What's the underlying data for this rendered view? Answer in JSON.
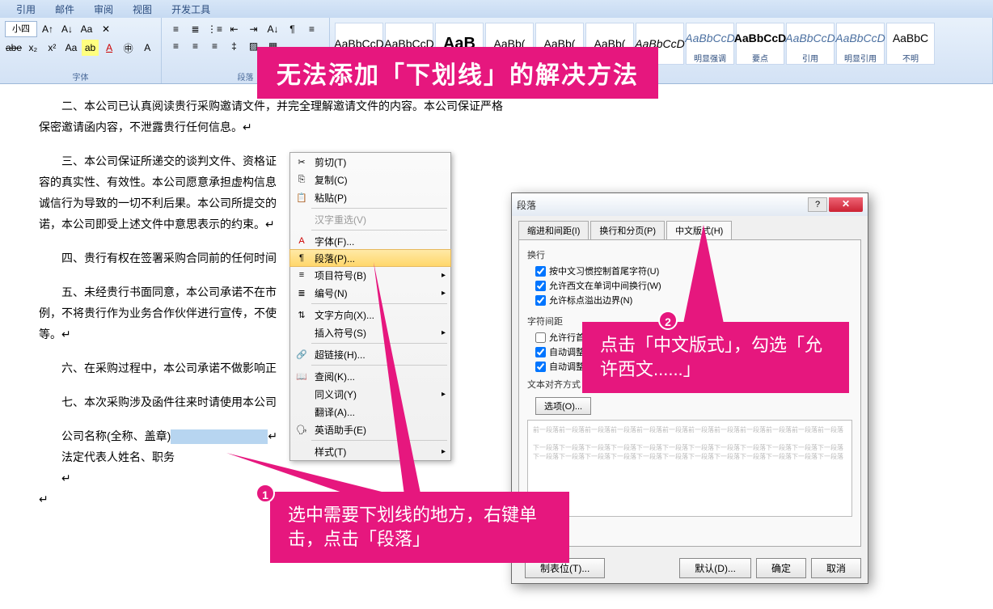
{
  "tabs": [
    "引用",
    "邮件",
    "审阅",
    "视图",
    "开发工具"
  ],
  "font": {
    "size": "小四",
    "group": "字体"
  },
  "para": {
    "group": "段落"
  },
  "styles": [
    {
      "prev": "AaBbCcD",
      "name": ""
    },
    {
      "prev": "AaBbCcD",
      "name": ""
    },
    {
      "prev": "AaB",
      "name": "",
      "bold": true,
      "big": true
    },
    {
      "prev": "AaBb(",
      "name": ""
    },
    {
      "prev": "AaBb(",
      "name": ""
    },
    {
      "prev": "AaBb(",
      "name": ""
    },
    {
      "prev": "AaBbCcD",
      "name": "",
      "italic": true
    },
    {
      "prev": "AaBbCcD",
      "name": "明显强调",
      "italic": true,
      "color": "#4a6fa0"
    },
    {
      "prev": "AaBbCcD",
      "name": "要点",
      "bold": true
    },
    {
      "prev": "AaBbCcD",
      "name": "引用",
      "italic": true,
      "color": "#4a6fa0"
    },
    {
      "prev": "AaBbCcD",
      "name": "明显引用",
      "italic": true,
      "color": "#4a6fa0"
    },
    {
      "prev": "AaBbC",
      "name": "不明"
    }
  ],
  "doc": {
    "p1": "二、本公司已认真阅读贵行采购邀请文件，并完全理解邀请文件的内容。本公司保证严格保密邀请函内容，不泄露贵行任何信息。↵",
    "p2": "三、本公司保证所递交的谈判文件、资格证",
    "p3": "容的真实性、有效性。本公司愿意承担虚构信息",
    "p4": "诚信行为导致的一切不利后果。本公司所提交的",
    "p5": "诺，本公司即受上述文件中意思表示的约束。↵",
    "p6": "四、贵行有权在签署采购合同前的任何时间",
    "p7": "五、未经贵行书面同意，本公司承诺不在市",
    "p8": "例，不将贵行作为业务合作伙伴进行宣传，不使",
    "p9": "等。↵",
    "p10": "六、在采购过程中，本公司承诺不做影响正",
    "p11": "七、本次采购涉及函件往来时请使用本公司",
    "p12": "公司名称(全称、盖章)",
    "p13": "法定代表人姓名、职务"
  },
  "ctx": {
    "cut": "剪切(T)",
    "copy": "复制(C)",
    "paste": "粘贴(P)",
    "recon": "汉字重选(V)",
    "font": "字体(F)...",
    "para": "段落(P)...",
    "bullets": "项目符号(B)",
    "number": "编号(N)",
    "dir": "文字方向(X)...",
    "symbol": "插入符号(S)",
    "link": "超链接(H)...",
    "lookup": "查阅(K)...",
    "syn": "同义词(Y)",
    "trans": "翻译(A)...",
    "eng": "英语助手(E)",
    "style": "样式(T)"
  },
  "dlg": {
    "title": "段落",
    "tab1": "缩进和间距(I)",
    "tab2": "换行和分页(P)",
    "tab3": "中文版式(H)",
    "grp1": "换行",
    "chk1": "按中文习惯控制首尾字符(U)",
    "chk2": "允许西文在单词中间换行(W)",
    "chk3": "允许标点溢出边界(N)",
    "grp2": "字符间距",
    "chk4": "允许行首标点压缩(C)",
    "chk5": "自动调整中文与西文的间距",
    "chk6": "自动调整中文与数字的间距",
    "grp3": "文本对齐方式",
    "opt": "选项(O)...",
    "tabsbtn": "制表位(T)...",
    "def": "默认(D)...",
    "ok": "确定",
    "cancel": "取消"
  },
  "anno": {
    "title": "无法添加「下划线」的解决方法",
    "a1": "选中需要下划线的地方，右键单击，点击「段落」",
    "a2": "点击「中文版式」，勾选「允许西文......」"
  }
}
